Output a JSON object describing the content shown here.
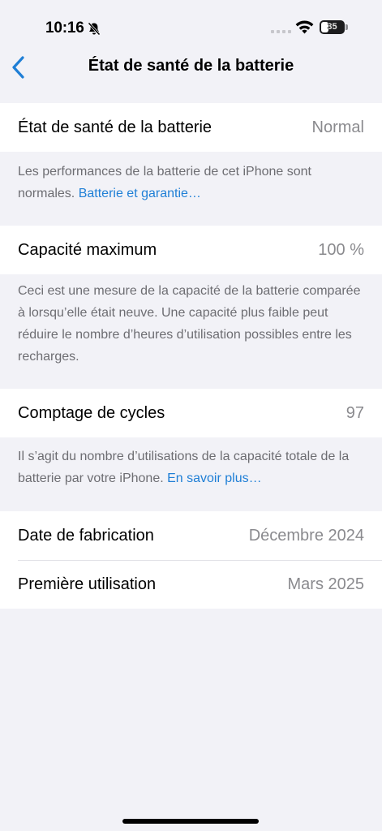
{
  "status_bar": {
    "time": "10:16",
    "battery_level": "35",
    "icons": [
      "bell-slash-icon",
      "cellular-signal-icon",
      "wifi-icon",
      "battery-icon"
    ]
  },
  "nav": {
    "back_icon": "chevron-left-icon",
    "title": "État de santé de la batterie",
    "accent_color": "#1f7fd6"
  },
  "health": {
    "label": "État de santé de la batterie",
    "value": "Normal",
    "note": "Les performances de la batterie de cet iPhone sont normales. ",
    "note_link": "Batterie et garantie…"
  },
  "capacity": {
    "label": "Capacité maximum",
    "value": "100 %",
    "note": "Ceci est une mesure de la capacité de la batterie comparée à lorsqu’elle était neuve. Une capacité plus faible peut réduire le nombre d’heures d’utilisation possibles entre les recharges."
  },
  "cycles": {
    "label": "Comptage de cycles",
    "value": "97",
    "note": "Il s’agit du nombre d’utilisations de la capacité totale de la batterie par votre iPhone. ",
    "note_link": "En savoir plus…"
  },
  "dates": {
    "manufacture_label": "Date de fabrication",
    "manufacture_value": "Décembre 2024",
    "first_use_label": "Première utilisation",
    "first_use_value": "Mars 2025"
  }
}
